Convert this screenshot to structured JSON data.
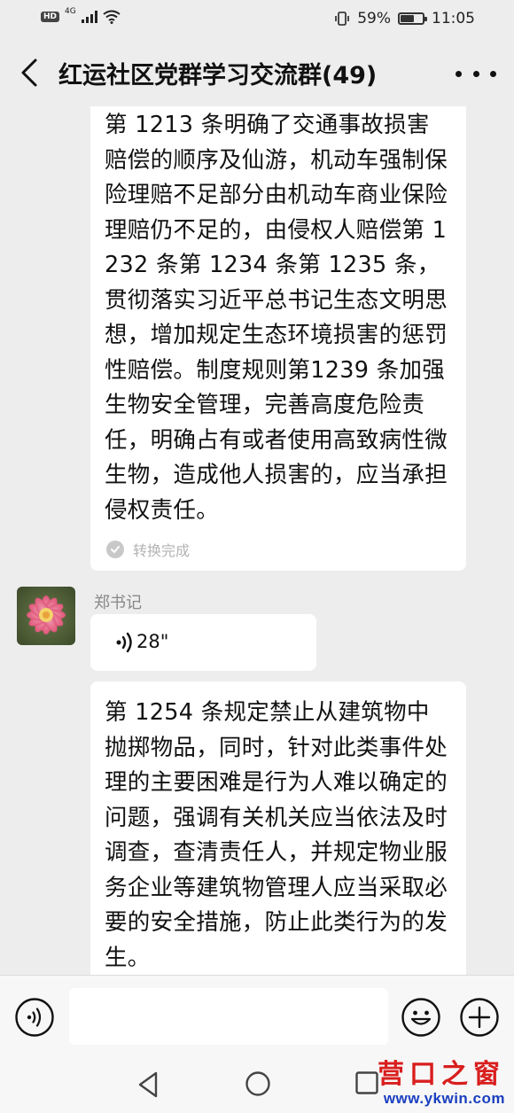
{
  "status_bar": {
    "network_badge": "HD",
    "network_type": "4G",
    "battery_percent": "59%",
    "battery_level": 0.59,
    "time": "11:05"
  },
  "header": {
    "title": "红运社区党群学习交流群(49)"
  },
  "messages": [
    {
      "type": "voice_to_text",
      "text": "第 1213 条明确了交通事故损害赔偿的顺序及仙游，机动车强制保险理赔不足部分由机动车商业保险理赔仍不足的，由侵权人赔偿第 1232 条第 1234 条第 1235 条，贯彻落实习近平总书记生态文明思想，增加规定生态环境损害的惩罚性赔偿。制度规则第1239 条加强生物安全管理，完善高度危险责任，明确占有或者使用高致病性微生物，造成他人损害的，应当承担侵权责任。",
      "status": "转换完成"
    },
    {
      "type": "voice",
      "sender": "郑书记",
      "duration": "28\"",
      "transcript": "第 1254 条规定禁止从建筑物中抛掷物品，同时，针对此类事件处理的主要困难是行为人难以确定的问题，强调有关机关应当依法及时调查，查清责任人，并规定物业服务企业等建筑物管理人应当采取必要的安全措施，防止此类行为的发生。"
    }
  ],
  "input_bar": {
    "placeholder": ""
  },
  "watermark": {
    "name": "营口之窗",
    "url": "www.ykwin.com"
  },
  "colors": {
    "background": "#ededed",
    "bubble": "#ffffff",
    "watermark_red": "#d91e1e",
    "watermark_blue": "#1a3fbf"
  }
}
